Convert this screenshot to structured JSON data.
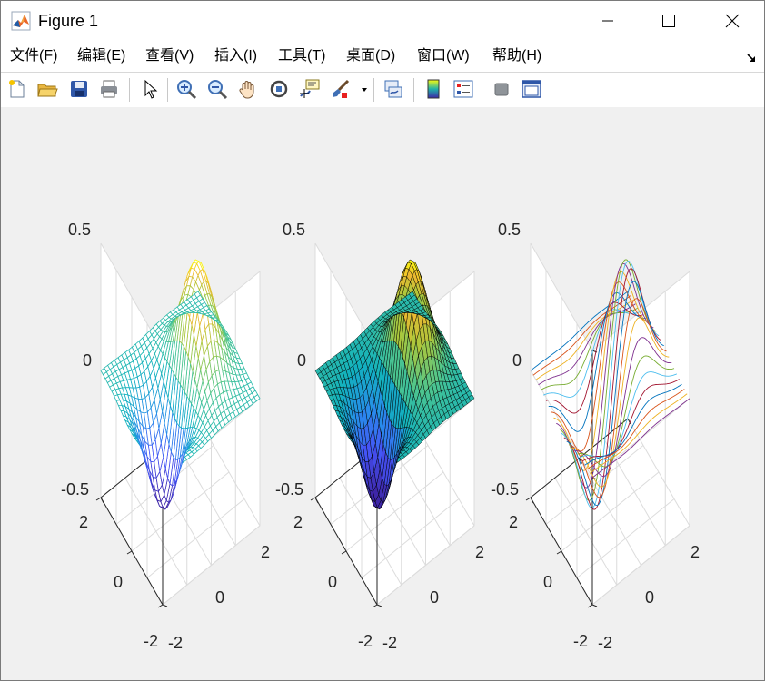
{
  "window": {
    "title": "Figure 1",
    "icons": {
      "app": "matlab-icon",
      "minimize": "minimize-icon",
      "maximize": "maximize-icon",
      "close": "close-icon"
    }
  },
  "menu": [
    "文件(F)",
    "编辑(E)",
    "查看(V)",
    "插入(I)",
    "工具(T)",
    "桌面(D)",
    "窗口(W)",
    "帮助(H)"
  ],
  "toolbar_icons": [
    "new-figure-icon",
    "open-file-icon",
    "save-icon",
    "print-icon",
    "pointer-icon",
    "zoom-in-icon",
    "zoom-out-icon",
    "pan-icon",
    "rotate-3d-icon",
    "data-cursor-icon",
    "brush-icon",
    "link-plot-icon",
    "colorbar-icon",
    "legend-icon",
    "hide-plot-tools-icon",
    "show-plot-tools-icon"
  ],
  "colors": {
    "accent_yellow": "#f9fb0e",
    "accent_teal": "#20b2aa",
    "accent_blue": "#3e26a8"
  },
  "chart_data": [
    {
      "type": "mesh",
      "zticks": [
        "0.5",
        "0",
        "-0.5"
      ],
      "yticks": [
        "2",
        "0",
        "-2"
      ],
      "xticks": [
        "-2",
        "0",
        "2"
      ],
      "zlim": [
        -0.5,
        0.5
      ],
      "xlim": [
        -2,
        2
      ],
      "ylim": [
        -2,
        2
      ],
      "grid": true
    },
    {
      "type": "surface",
      "zticks": [
        "0.5",
        "0",
        "-0.5"
      ],
      "yticks": [
        "2",
        "0",
        "-2"
      ],
      "xticks": [
        "-2",
        "0",
        "2"
      ],
      "zlim": [
        -0.5,
        0.5
      ],
      "xlim": [
        -2,
        2
      ],
      "ylim": [
        -2,
        2
      ],
      "grid": true
    },
    {
      "type": "line3d",
      "zticks": [
        "0.5",
        "0",
        "-0.5"
      ],
      "yticks": [
        "2",
        "0",
        "-2"
      ],
      "xticks": [
        "-2",
        "0",
        "2"
      ],
      "zlim": [
        -0.5,
        0.5
      ],
      "xlim": [
        -2,
        2
      ],
      "ylim": [
        -2,
        2
      ],
      "grid": true
    }
  ]
}
